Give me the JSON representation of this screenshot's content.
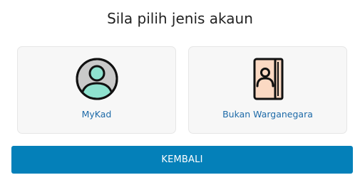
{
  "heading": "Sila pilih jenis akaun",
  "options": [
    {
      "label": "MyKad",
      "icon": "user-avatar-icon"
    },
    {
      "label": "Bukan Warganegara",
      "icon": "passport-book-icon"
    }
  ],
  "back_button_label": "KEMBALI",
  "colors": {
    "accent": "#0480b9",
    "link": "#1d6aa8",
    "card_bg": "#f7f7f7",
    "avatar_body": "#8fe2cf",
    "book_cover": "#fbd9c3"
  }
}
